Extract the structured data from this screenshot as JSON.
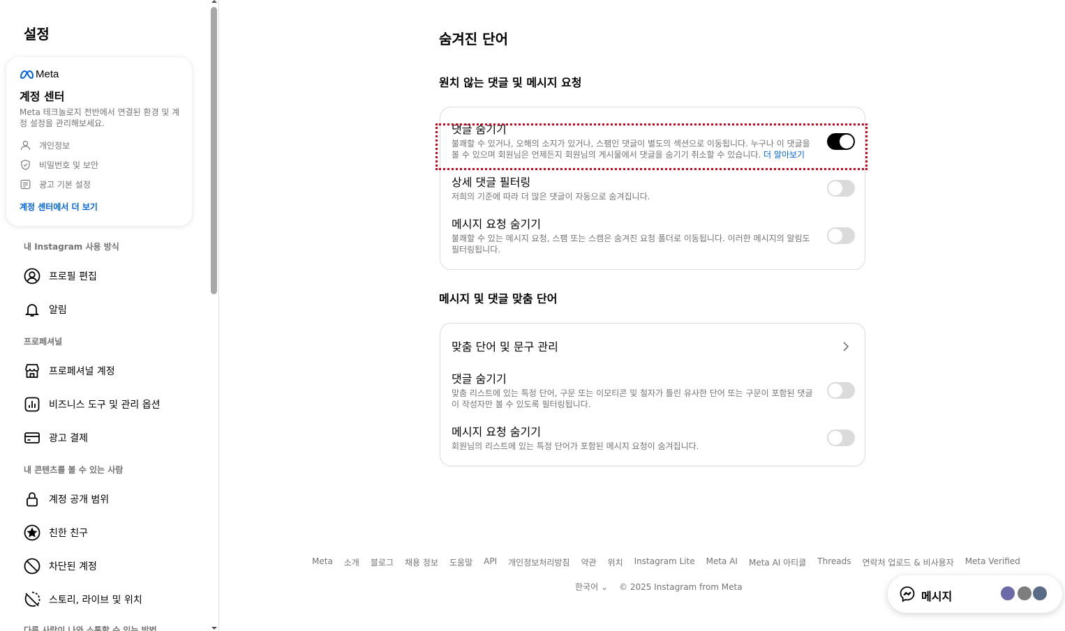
{
  "sidebar": {
    "title": "설정",
    "accounts_center": {
      "brand": "Meta",
      "title": "계정 센터",
      "description": "Meta 테크놀로지 전반에서 연결된 환경 및 계정 설정을 관리해보세요.",
      "items": [
        {
          "label": "개인정보",
          "icon": "person-icon"
        },
        {
          "label": "비밀번호 및 보안",
          "icon": "shield-check-icon"
        },
        {
          "label": "광고 기본 설정",
          "icon": "ad-preferences-icon"
        }
      ],
      "more_link": "계정 센터에서 더 보기"
    },
    "sections": [
      {
        "label": "내 Instagram 사용 방식",
        "items": [
          {
            "label": "프로필 편집",
            "icon": "profile-circle-icon"
          },
          {
            "label": "알림",
            "icon": "bell-icon"
          }
        ]
      },
      {
        "label": "프로페셔널",
        "items": [
          {
            "label": "프로페셔널 계정",
            "icon": "storefront-icon"
          },
          {
            "label": "비즈니스 도구 및 관리 옵션",
            "icon": "bar-chart-icon"
          },
          {
            "label": "광고 결제",
            "icon": "credit-card-icon"
          }
        ]
      },
      {
        "label": "내 콘텐츠를 볼 수 있는 사람",
        "items": [
          {
            "label": "계정 공개 범위",
            "icon": "lock-icon"
          },
          {
            "label": "친한 친구",
            "icon": "star-circle-icon"
          },
          {
            "label": "차단된 계정",
            "icon": "block-icon"
          },
          {
            "label": "스토리, 라이브 및 위치",
            "icon": "story-off-icon"
          }
        ]
      },
      {
        "label": "다른 사람이 나와 소통할 수 있는 방법",
        "items": []
      }
    ]
  },
  "main": {
    "title": "숨겨진 단어",
    "groups": [
      {
        "title": "원치 않는 댓글 및 메시지 요청",
        "rows": [
          {
            "title": "댓글 숨기기",
            "desc": "불쾌할 수 있거나, 오해의 소지가 있거나, 스팸인 댓글이 별도의 섹션으로 이동됩니다. 누구나 이 댓글을 볼 수 있으며 회원님은 언제든지 회원님의 게시물에서 댓글을 숨기기 취소할 수 있습니다.",
            "link": "더 알아보기",
            "toggle": true
          },
          {
            "title": "상세 댓글 필터링",
            "desc": "저희의 기준에 따라 더 많은 댓글이 자동으로 숨겨집니다.",
            "toggle": false
          },
          {
            "title": "메시지 요청 숨기기",
            "desc": "불쾌할 수 있는 메시지 요청, 스팸 또는 스캠은 숨겨진 요청 폴더로 이동됩니다. 이러한 메시지의 알림도 필터링됩니다.",
            "toggle": false
          }
        ]
      },
      {
        "title": "메시지 및 댓글 맞춤 단어",
        "manage_label": "맞춤 단어 및 문구 관리",
        "rows": [
          {
            "title": "댓글 숨기기",
            "desc": "맞춤 리스트에 있는 특정 단어, 구문 또는 이모티콘 및 철자가 틀린 유사한 단어 또는 구문이 포함된 댓글이 작성자만 볼 수 있도록 필터링됩니다.",
            "toggle": false
          },
          {
            "title": "메시지 요청 숨기기",
            "desc": "회원님의 리스트에 있는 특정 단어가 포함된 메시지 요청이 숨겨집니다.",
            "toggle": false
          }
        ]
      }
    ]
  },
  "footer": {
    "links": [
      "Meta",
      "소개",
      "블로그",
      "채용 정보",
      "도움말",
      "API",
      "개인정보처리방침",
      "약관",
      "위치",
      "Instagram Lite",
      "Meta AI",
      "Meta AI 아티클",
      "Threads",
      "연락처 업로드 & 비사용자",
      "Meta Verified"
    ],
    "language": "한국어",
    "copyright": "© 2025 Instagram from Meta"
  },
  "messages": {
    "label": "메시지"
  },
  "colors": {
    "accent": "#0064e0",
    "focus_outline": "#d0021b",
    "toggle_on": "#000000",
    "toggle_off": "#dbdbdb"
  }
}
